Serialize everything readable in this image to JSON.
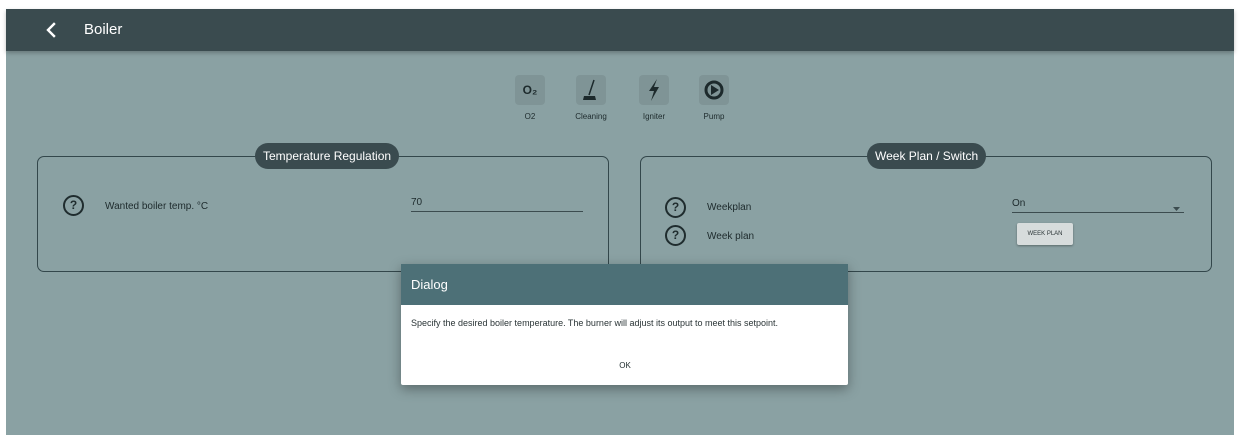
{
  "header": {
    "back_icon": "chevron-left-icon",
    "title": "Boiler"
  },
  "status_icons": [
    {
      "label": "O2",
      "icon": "o2-icon",
      "glyph": "O₂"
    },
    {
      "label": "Cleaning",
      "icon": "broom-icon"
    },
    {
      "label": "Igniter",
      "icon": "lightning-icon"
    },
    {
      "label": "Pump",
      "icon": "pump-icon"
    }
  ],
  "temperature_panel": {
    "title": "Temperature Regulation",
    "wanted_label": "Wanted boiler temp. °C",
    "wanted_value": "70"
  },
  "weekplan_panel": {
    "title": "Week Plan / Switch",
    "weekplan_label": "Weekplan",
    "weekplan_value": "On",
    "week_plan_label": "Week plan",
    "week_plan_button": "WEEK PLAN"
  },
  "dialog": {
    "title": "Dialog",
    "message": "Specify the desired boiler temperature. The burner will adjust its output to meet this setpoint.",
    "ok_label": "OK"
  },
  "colors": {
    "topbar": "#3a4b4f",
    "background": "#8aa1a3",
    "dialog_header": "#4d7077"
  }
}
